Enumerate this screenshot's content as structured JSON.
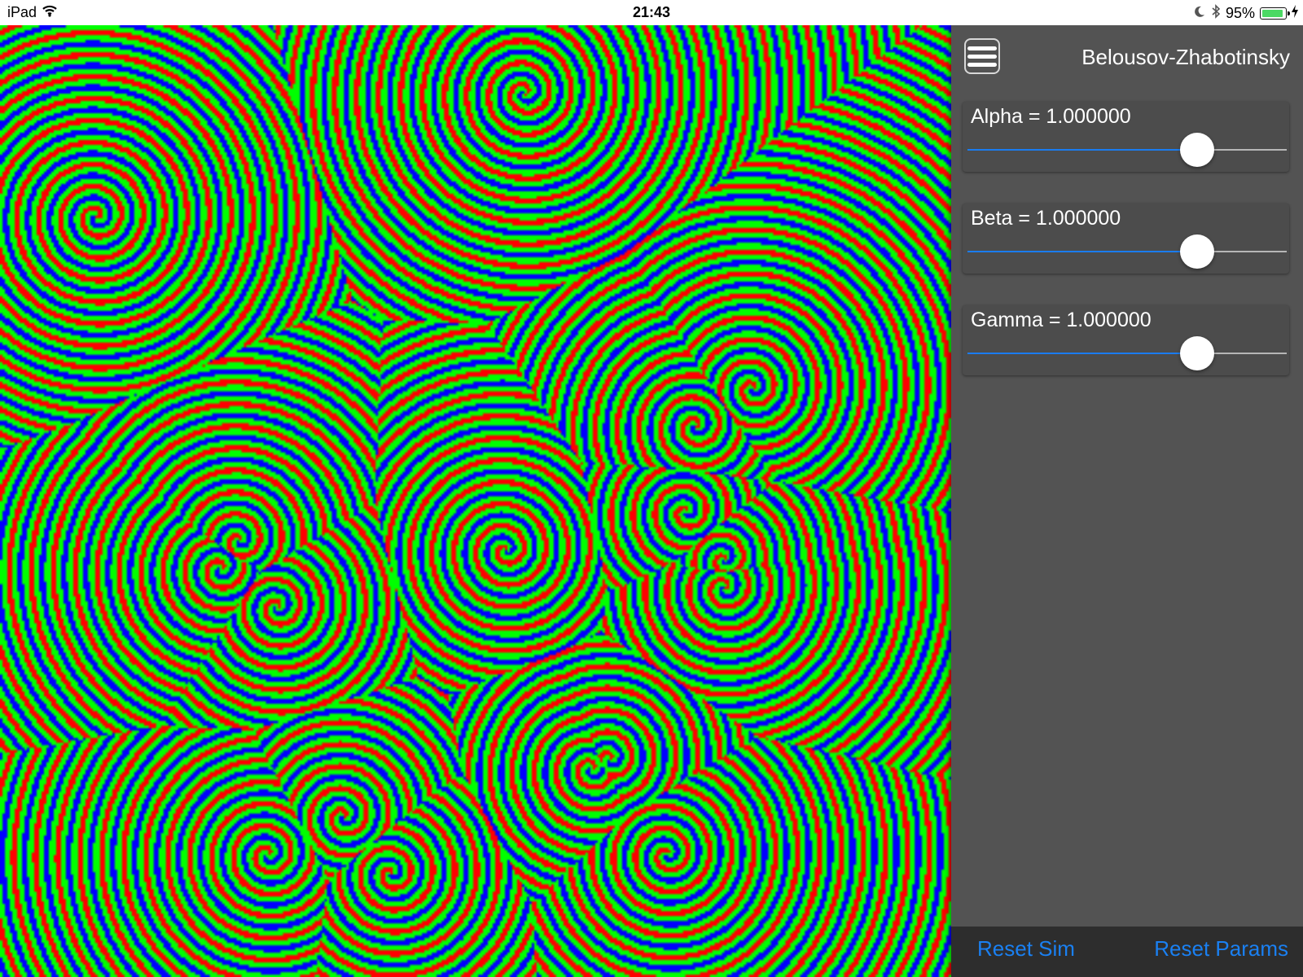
{
  "status_bar": {
    "device": "iPad",
    "time": "21:43",
    "battery_percent_text": "95%",
    "battery_level": 0.95,
    "icons": [
      "wifi-icon",
      "moon-icon",
      "bluetooth-icon",
      "battery-icon",
      "charging-icon"
    ]
  },
  "simulation": {
    "colors": [
      "#ff0000",
      "#00ff00",
      "#0000ff"
    ]
  },
  "sidebar": {
    "title": "Belousov-Zhabotinsky",
    "menu_icon": "hamburger-menu-icon",
    "params": [
      {
        "label": "Alpha = 1.000000",
        "value": 1.0,
        "slider_fraction": 0.72
      },
      {
        "label": "Beta = 1.000000",
        "value": 1.0,
        "slider_fraction": 0.72
      },
      {
        "label": "Gamma = 1.000000",
        "value": 1.0,
        "slider_fraction": 0.72
      }
    ],
    "buttons": {
      "reset_sim": "Reset Sim",
      "reset_params": "Reset Params"
    }
  },
  "colors": {
    "sidebar_bg": "#535353",
    "card_bg": "#4c4c4c",
    "bottom_bar_bg": "#2d2d2d",
    "accent": "#1a80f2",
    "slider_fill": "#1a7cf0"
  }
}
